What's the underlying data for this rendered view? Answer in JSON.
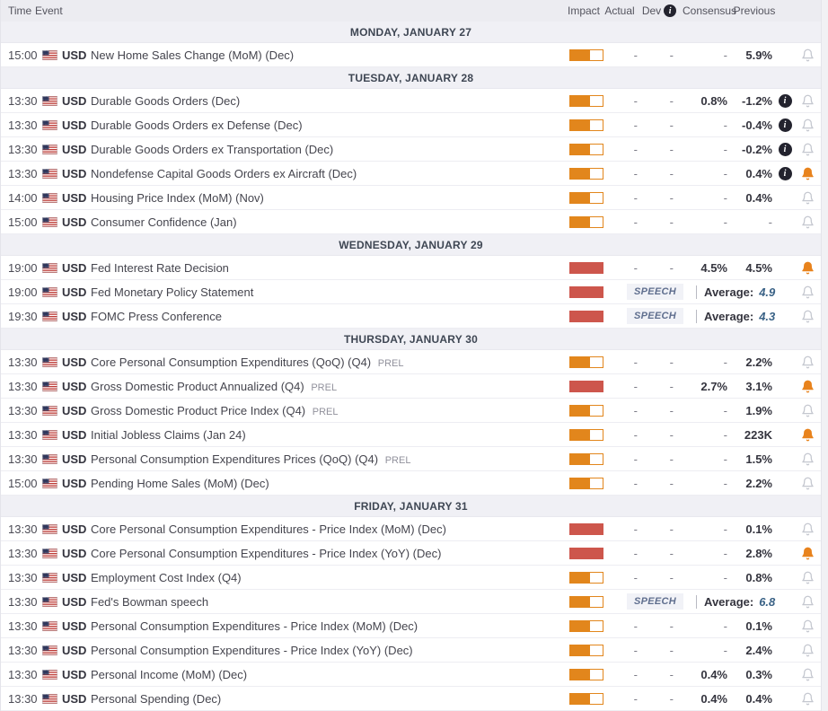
{
  "header": {
    "time": "Time",
    "event": "Event",
    "impact": "Impact",
    "actual": "Actual",
    "dev": "Dev",
    "consensus": "Consensus",
    "previous": "Previous"
  },
  "labels": {
    "speech": "SPEECH",
    "average": "Average:"
  },
  "colors": {
    "impact_medium": "#e2861c",
    "impact_high": "#cd564c",
    "bell_active": "#e8831d",
    "speech_text": "#5f6e8e",
    "average_value": "#3a6286",
    "day_separator_bg": "#f0f0f5",
    "header_bg": "#ececf1"
  },
  "days": [
    {
      "label": "MONDAY, JANUARY 27",
      "events": [
        {
          "time": "15:00",
          "currency": "USD",
          "name": "New Home Sales Change (MoM) (Dec)",
          "tag": "",
          "impact": "medium",
          "actual": "-",
          "dev": "-",
          "consensus": "-",
          "previous": "5.9%",
          "info": false,
          "bell": "inactive"
        }
      ]
    },
    {
      "label": "TUESDAY, JANUARY 28",
      "events": [
        {
          "time": "13:30",
          "currency": "USD",
          "name": "Durable Goods Orders (Dec)",
          "tag": "",
          "impact": "medium",
          "actual": "-",
          "dev": "-",
          "consensus": "0.8%",
          "previous": "-1.2%",
          "info": true,
          "bell": "inactive"
        },
        {
          "time": "13:30",
          "currency": "USD",
          "name": "Durable Goods Orders ex Defense (Dec)",
          "tag": "",
          "impact": "medium",
          "actual": "-",
          "dev": "-",
          "consensus": "-",
          "previous": "-0.4%",
          "info": true,
          "bell": "inactive"
        },
        {
          "time": "13:30",
          "currency": "USD",
          "name": "Durable Goods Orders ex Transportation (Dec)",
          "tag": "",
          "impact": "medium",
          "actual": "-",
          "dev": "-",
          "consensus": "-",
          "previous": "-0.2%",
          "info": true,
          "bell": "inactive"
        },
        {
          "time": "13:30",
          "currency": "USD",
          "name": "Nondefense Capital Goods Orders ex Aircraft (Dec)",
          "tag": "",
          "impact": "medium",
          "actual": "-",
          "dev": "-",
          "consensus": "-",
          "previous": "0.4%",
          "info": true,
          "bell": "active"
        },
        {
          "time": "14:00",
          "currency": "USD",
          "name": "Housing Price Index (MoM) (Nov)",
          "tag": "",
          "impact": "medium",
          "actual": "-",
          "dev": "-",
          "consensus": "-",
          "previous": "0.4%",
          "info": false,
          "bell": "inactive"
        },
        {
          "time": "15:00",
          "currency": "USD",
          "name": "Consumer Confidence (Jan)",
          "tag": "",
          "impact": "medium",
          "actual": "-",
          "dev": "-",
          "consensus": "-",
          "previous": "-",
          "info": false,
          "bell": "inactive"
        }
      ]
    },
    {
      "label": "WEDNESDAY, JANUARY 29",
      "events": [
        {
          "time": "19:00",
          "currency": "USD",
          "name": "Fed Interest Rate Decision",
          "tag": "",
          "impact": "high",
          "actual": "-",
          "dev": "-",
          "consensus": "4.5%",
          "previous": "4.5%",
          "info": false,
          "bell": "active"
        },
        {
          "time": "19:00",
          "currency": "USD",
          "name": "Fed Monetary Policy Statement",
          "tag": "",
          "impact": "high",
          "speech_average": "4.9",
          "info": false,
          "bell": "inactive"
        },
        {
          "time": "19:30",
          "currency": "USD",
          "name": "FOMC Press Conference",
          "tag": "",
          "impact": "high",
          "speech_average": "4.3",
          "info": false,
          "bell": "inactive"
        }
      ]
    },
    {
      "label": "THURSDAY, JANUARY 30",
      "events": [
        {
          "time": "13:30",
          "currency": "USD",
          "name": "Core Personal Consumption Expenditures (QoQ) (Q4)",
          "tag": "PREL",
          "impact": "medium",
          "actual": "-",
          "dev": "-",
          "consensus": "-",
          "previous": "2.2%",
          "info": false,
          "bell": "inactive"
        },
        {
          "time": "13:30",
          "currency": "USD",
          "name": "Gross Domestic Product Annualized (Q4)",
          "tag": "PREL",
          "impact": "high",
          "actual": "-",
          "dev": "-",
          "consensus": "2.7%",
          "previous": "3.1%",
          "info": false,
          "bell": "active"
        },
        {
          "time": "13:30",
          "currency": "USD",
          "name": "Gross Domestic Product Price Index (Q4)",
          "tag": "PREL",
          "impact": "medium",
          "actual": "-",
          "dev": "-",
          "consensus": "-",
          "previous": "1.9%",
          "info": false,
          "bell": "inactive"
        },
        {
          "time": "13:30",
          "currency": "USD",
          "name": "Initial Jobless Claims (Jan 24)",
          "tag": "",
          "impact": "medium",
          "actual": "-",
          "dev": "-",
          "consensus": "-",
          "previous": "223K",
          "info": false,
          "bell": "active"
        },
        {
          "time": "13:30",
          "currency": "USD",
          "name": "Personal Consumption Expenditures Prices (QoQ) (Q4)",
          "tag": "PREL",
          "impact": "medium",
          "actual": "-",
          "dev": "-",
          "consensus": "-",
          "previous": "1.5%",
          "info": false,
          "bell": "inactive"
        },
        {
          "time": "15:00",
          "currency": "USD",
          "name": "Pending Home Sales (MoM) (Dec)",
          "tag": "",
          "impact": "medium",
          "actual": "-",
          "dev": "-",
          "consensus": "-",
          "previous": "2.2%",
          "info": false,
          "bell": "inactive"
        }
      ]
    },
    {
      "label": "FRIDAY, JANUARY 31",
      "events": [
        {
          "time": "13:30",
          "currency": "USD",
          "name": "Core Personal Consumption Expenditures - Price Index (MoM) (Dec)",
          "tag": "",
          "impact": "high",
          "actual": "-",
          "dev": "-",
          "consensus": "-",
          "previous": "0.1%",
          "info": false,
          "bell": "inactive"
        },
        {
          "time": "13:30",
          "currency": "USD",
          "name": "Core Personal Consumption Expenditures - Price Index (YoY) (Dec)",
          "tag": "",
          "impact": "high",
          "actual": "-",
          "dev": "-",
          "consensus": "-",
          "previous": "2.8%",
          "info": false,
          "bell": "active"
        },
        {
          "time": "13:30",
          "currency": "USD",
          "name": "Employment Cost Index (Q4)",
          "tag": "",
          "impact": "medium",
          "actual": "-",
          "dev": "-",
          "consensus": "-",
          "previous": "0.8%",
          "info": false,
          "bell": "inactive"
        },
        {
          "time": "13:30",
          "currency": "USD",
          "name": "Fed's Bowman speech",
          "tag": "",
          "impact": "medium",
          "speech_average": "6.8",
          "info": false,
          "bell": "inactive"
        },
        {
          "time": "13:30",
          "currency": "USD",
          "name": "Personal Consumption Expenditures - Price Index (MoM) (Dec)",
          "tag": "",
          "impact": "medium",
          "actual": "-",
          "dev": "-",
          "consensus": "-",
          "previous": "0.1%",
          "info": false,
          "bell": "inactive"
        },
        {
          "time": "13:30",
          "currency": "USD",
          "name": "Personal Consumption Expenditures - Price Index (YoY) (Dec)",
          "tag": "",
          "impact": "medium",
          "actual": "-",
          "dev": "-",
          "consensus": "-",
          "previous": "2.4%",
          "info": false,
          "bell": "inactive"
        },
        {
          "time": "13:30",
          "currency": "USD",
          "name": "Personal Income (MoM) (Dec)",
          "tag": "",
          "impact": "medium",
          "actual": "-",
          "dev": "-",
          "consensus": "0.4%",
          "previous": "0.3%",
          "info": false,
          "bell": "inactive"
        },
        {
          "time": "13:30",
          "currency": "USD",
          "name": "Personal Spending (Dec)",
          "tag": "",
          "impact": "medium",
          "actual": "-",
          "dev": "-",
          "consensus": "0.4%",
          "previous": "0.4%",
          "info": false,
          "bell": "inactive"
        }
      ]
    }
  ]
}
